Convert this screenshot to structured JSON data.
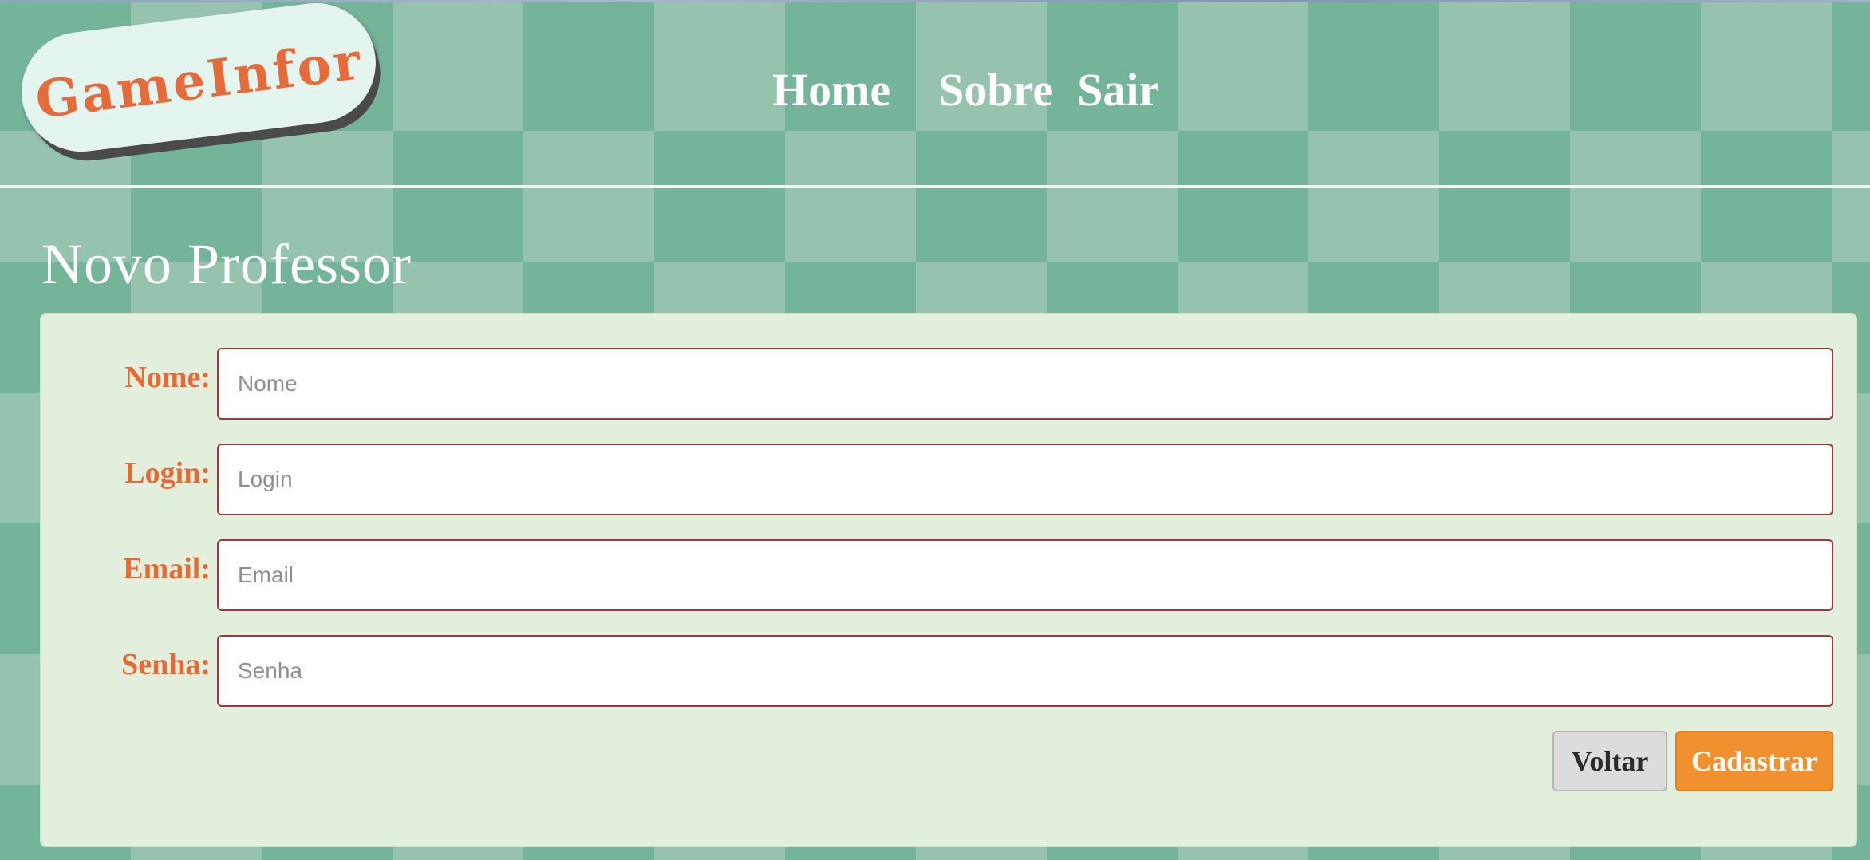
{
  "header": {
    "logo_text": "GameInfor",
    "nav": {
      "home": "Home",
      "sobre": "Sobre",
      "sair": "Sair"
    }
  },
  "page": {
    "title": "Novo Professor"
  },
  "form": {
    "fields": [
      {
        "label": "Nome:",
        "placeholder": "Nome",
        "value": ""
      },
      {
        "label": "Login:",
        "placeholder": "Login",
        "value": ""
      },
      {
        "label": "Email:",
        "placeholder": "Email",
        "value": ""
      },
      {
        "label": "Senha:",
        "placeholder": "Senha",
        "value": ""
      }
    ],
    "buttons": {
      "back": "Voltar",
      "submit": "Cadastrar"
    }
  },
  "colors": {
    "background_dark": "#74b498",
    "background_light": "#96c3ae",
    "accent": "#e66b3b",
    "panel": "#e2efdc",
    "submit": "#f0902f"
  }
}
